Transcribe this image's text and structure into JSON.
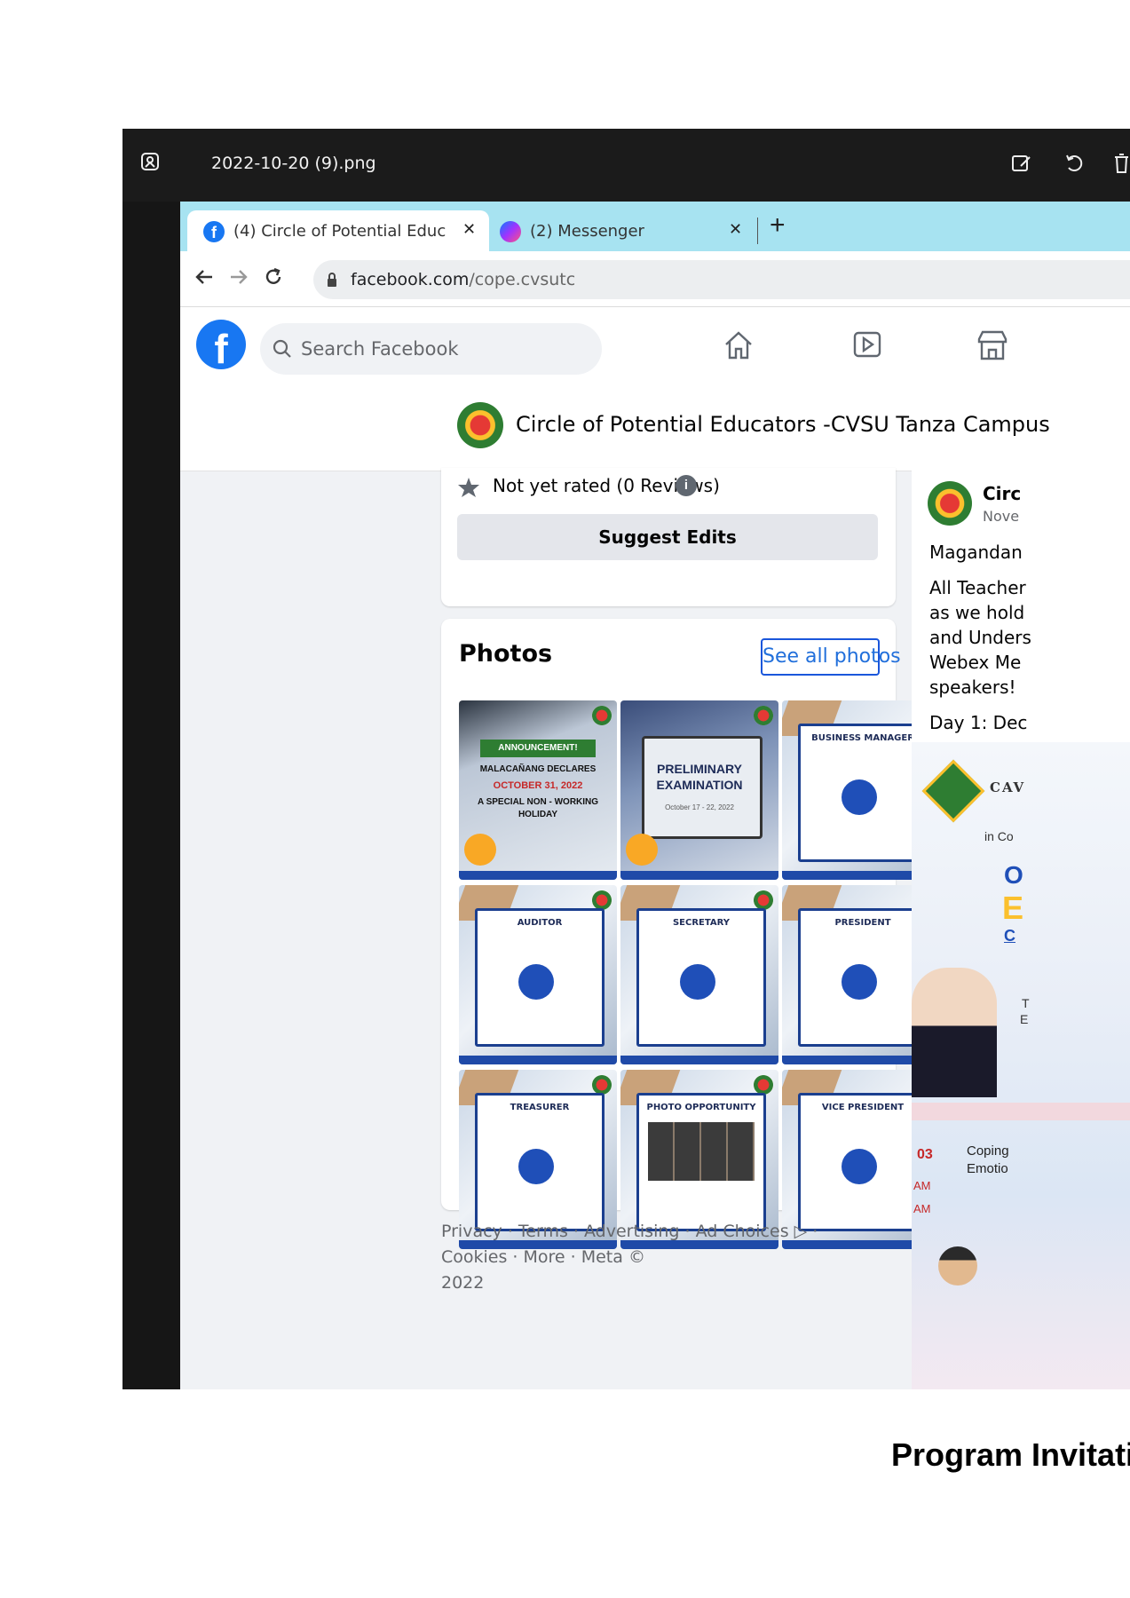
{
  "viewer": {
    "filename": "2022-10-20 (9).png"
  },
  "tabs": [
    {
      "label": "(4) Circle of Potential Educators -",
      "close": "✕"
    },
    {
      "label": "(2) Messenger",
      "close": "✕"
    }
  ],
  "new_tab": "+",
  "address": {
    "domain": "facebook.com",
    "path": "/cope.cvsutc"
  },
  "search": {
    "placeholder": "Search Facebook"
  },
  "page": {
    "name": "Circle of Potential Educators -CVSU Tanza Campus"
  },
  "rating": {
    "text": "Not yet rated (0 Reviews)",
    "info": "i"
  },
  "suggest_edits": "Suggest Edits",
  "photos": {
    "title": "Photos",
    "see_all": "See all photos",
    "items": [
      {
        "label": "ANNOUNCEMENT!",
        "sub": "MALACAÑANG DECLARES",
        "date": "OCTOBER 31, 2022",
        "extra": "A SPECIAL NON - WORKING HOLIDAY"
      },
      {
        "label": "PRELIMINARY EXAMINATION",
        "sub": "October 17 - 22, 2022"
      },
      {
        "label": "BUSINESS MANAGER"
      },
      {
        "label": "AUDITOR"
      },
      {
        "label": "SECRETARY"
      },
      {
        "label": "PRESIDENT"
      },
      {
        "label": "TREASURER"
      },
      {
        "label": "PHOTO OPPORTUNITY"
      },
      {
        "label": "VICE PRESIDENT"
      }
    ]
  },
  "footer": {
    "line1": "Privacy · Terms · Advertising · Ad Choices ▷ · Cookies · More · Meta ©",
    "line2": "2022"
  },
  "post": {
    "author": "Circ",
    "date": "Nove",
    "lines": [
      "Magandan",
      "All Teacher",
      "as we hold",
      "and Unders",
      "Webex Me",
      "speakers!",
      "Day 1: Dec"
    ],
    "image_texts": {
      "org": "CAV",
      "incoop": "in Co",
      "big1": "O",
      "big2": "E",
      "small": "C",
      "side1": "T",
      "side2": "E",
      "day": "03",
      "am1": "AM",
      "am2": "AM",
      "topic1": "Coping",
      "topic2": "Emotio"
    }
  },
  "caption": "Program Invitati"
}
